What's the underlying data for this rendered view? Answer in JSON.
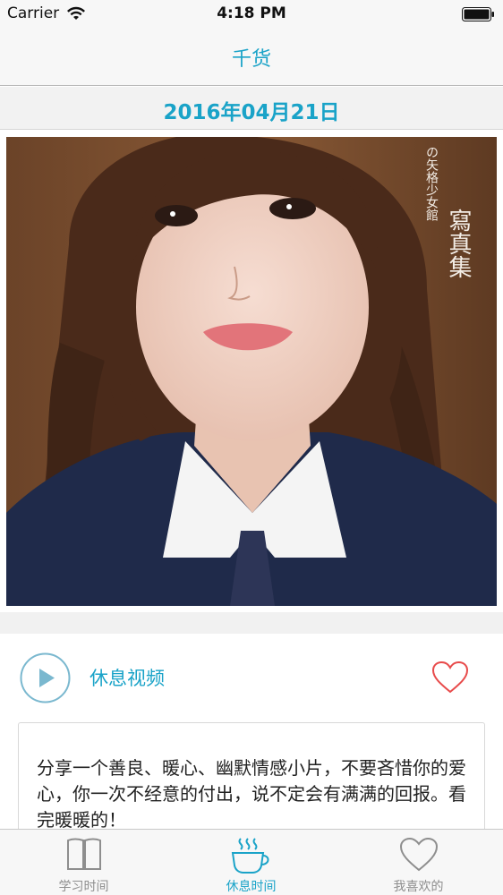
{
  "status_bar": {
    "carrier": "Carrier",
    "time": "4:18 PM",
    "icons": [
      "wifi-icon",
      "battery-icon"
    ]
  },
  "nav": {
    "title": "千货"
  },
  "date_header": "2016年04月21日",
  "photo": {
    "overlay_text_large": "寫真集",
    "overlay_text_small": "の矢格少女館"
  },
  "video": {
    "label": "休息视频",
    "play_icon": "play-icon",
    "favorite_icon": "heart-icon"
  },
  "description": "分享一个善良、暖心、幽默情感小片，不要吝惜你的爱心，你一次不经意的付出，说不定会有满满的回报。看完暖暖的！",
  "tabs": [
    {
      "label": "学习时间",
      "icon": "book-icon",
      "active": false
    },
    {
      "label": "休息时间",
      "icon": "coffee-icon",
      "active": true
    },
    {
      "label": "我喜欢的",
      "icon": "heart-icon",
      "active": false
    }
  ],
  "colors": {
    "accent": "#1aa3c8",
    "heart": "#e84b4b",
    "inactive": "#8e8e8e"
  }
}
